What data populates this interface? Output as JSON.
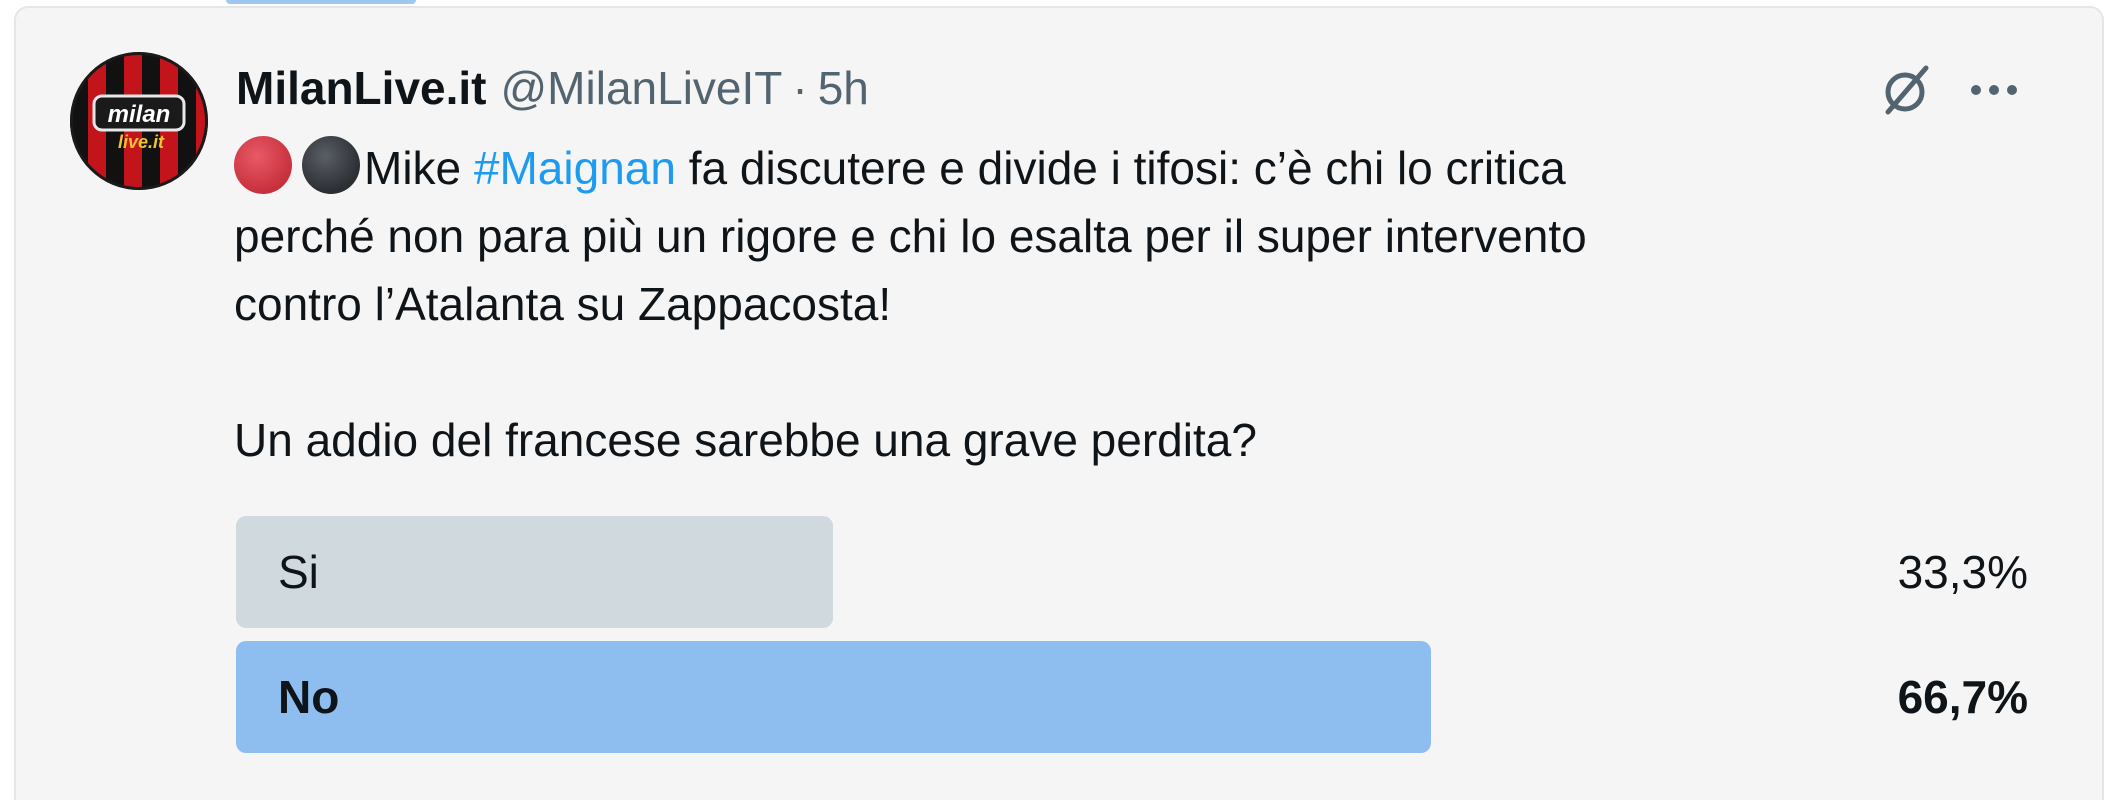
{
  "tweet": {
    "author": {
      "display_name": "MilanLive.it",
      "handle": "@MilanLiveIT",
      "separator": "·",
      "time": "5h",
      "avatar_text_top": "milan",
      "avatar_text_bottom": "live.it"
    },
    "text": {
      "line1_prefix": "Mike ",
      "hashtag": "#Maignan",
      "line1_suffix": " fa discutere e divide i tifosi: c’è chi lo critica",
      "line2": "perché non para più un rigore e chi lo esalta per il super intervento",
      "line3": "contro l’Atalanta su Zappacosta!",
      "line4": "Un addio del francese sarebbe una grave perdita?"
    },
    "poll": {
      "options": [
        {
          "label": "Si",
          "percent_text": "33,3%",
          "fraction": 0.333,
          "winner": false,
          "color": "#cfd9de"
        },
        {
          "label": "No",
          "percent_text": "66,7%",
          "fraction": 0.667,
          "winner": true,
          "color": "#8ebef0"
        }
      ]
    },
    "icons": {
      "grok": "grok-icon",
      "more": "more-icon"
    }
  },
  "colors": {
    "card_background": "#f5f5f5",
    "hashtag": "#1d9bf0",
    "secondary_text": "#536471",
    "emoji_red": "#c8303d",
    "emoji_black": "#2b2e33"
  }
}
